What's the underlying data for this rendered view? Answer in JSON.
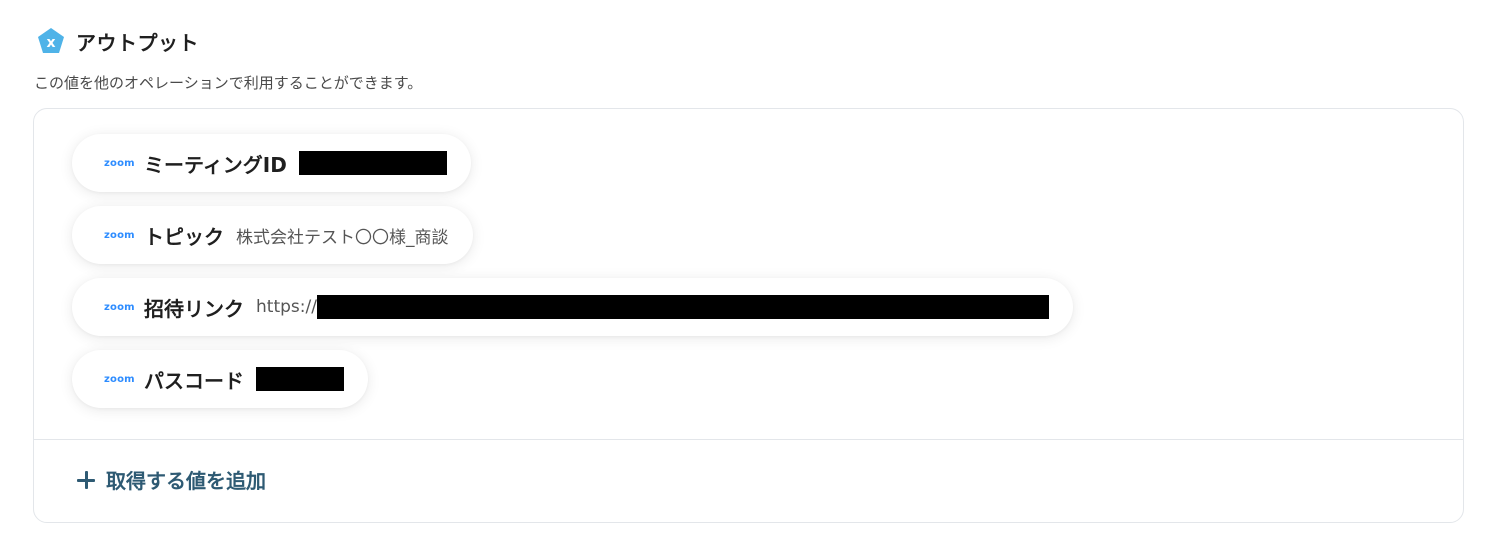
{
  "header": {
    "title": "アウトプット",
    "icon": "variable-icon",
    "icon_letter": "x",
    "icon_color": "#4fb3e8"
  },
  "description": "この値を他のオペレーションで利用することができます。",
  "outputs": [
    {
      "source": "zoom",
      "label": "ミーティングID",
      "value": "",
      "redacted": true
    },
    {
      "source": "zoom",
      "label": "トピック",
      "value": "株式会社テスト〇〇様_商談",
      "redacted": false
    },
    {
      "source": "zoom",
      "label": "招待リンク",
      "value": "https://",
      "redacted": true
    },
    {
      "source": "zoom",
      "label": "パスコード",
      "value": "",
      "redacted": true
    }
  ],
  "add_button": {
    "label": "取得する値を追加",
    "icon": "plus-icon"
  },
  "colors": {
    "accent": "#2e5a73",
    "zoom_brand": "#2d8cff",
    "border": "#e3e6ea",
    "redaction": "#000000"
  }
}
